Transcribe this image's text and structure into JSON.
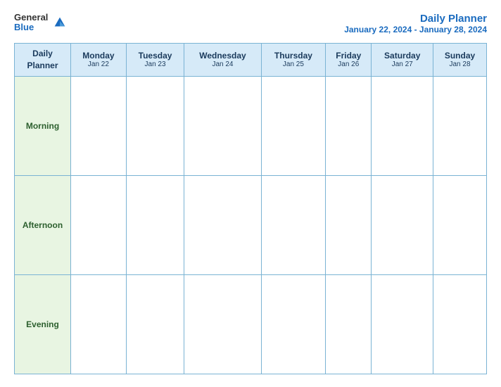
{
  "brand": {
    "general": "General",
    "blue": "Blue"
  },
  "header": {
    "title": "Daily Planner",
    "date_range": "January 22, 2024 - January 28, 2024"
  },
  "table": {
    "label_col": {
      "header": "Daily Planner",
      "rows": [
        "Morning",
        "Afternoon",
        "Evening"
      ]
    },
    "days": [
      {
        "name": "Monday",
        "date": "Jan 22"
      },
      {
        "name": "Tuesday",
        "date": "Jan 23"
      },
      {
        "name": "Wednesday",
        "date": "Jan 24"
      },
      {
        "name": "Thursday",
        "date": "Jan 25"
      },
      {
        "name": "Friday",
        "date": "Jan 26"
      },
      {
        "name": "Saturday",
        "date": "Jan 27"
      },
      {
        "name": "Sunday",
        "date": "Jan 28"
      }
    ]
  }
}
